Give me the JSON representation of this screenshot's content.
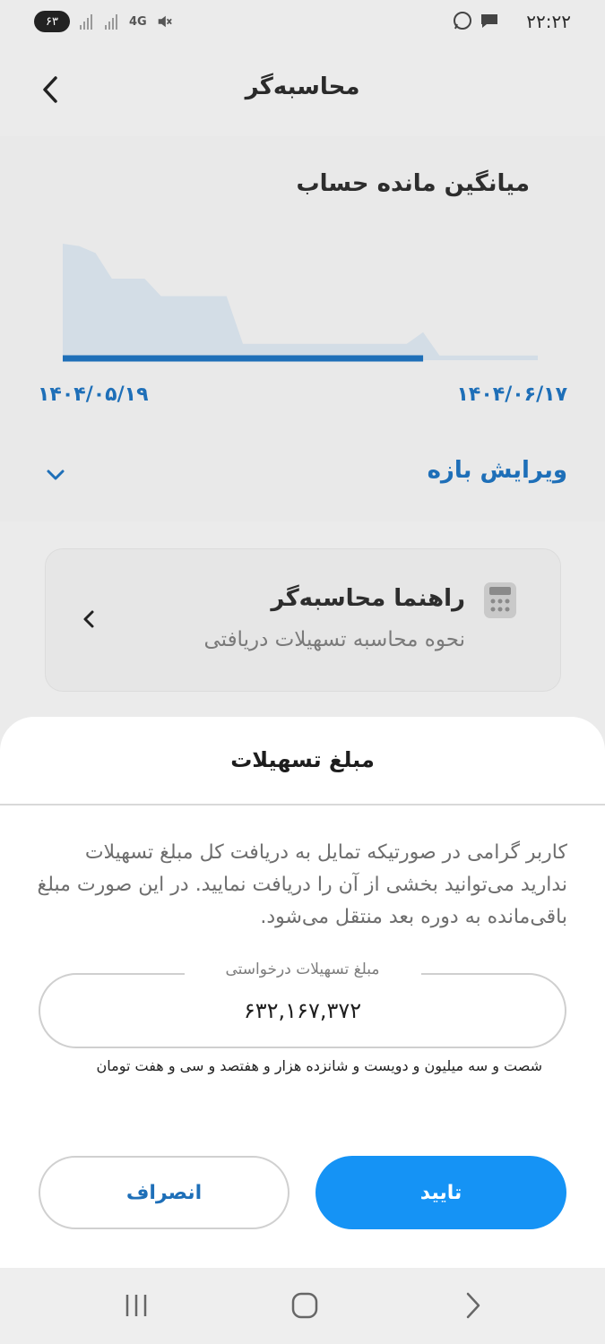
{
  "status_bar": {
    "time": "۲۲:۲۲",
    "battery": "۶۳",
    "network": "4G",
    "icons": [
      "whatsapp-icon",
      "message-icon",
      "mute-icon",
      "signal-icon"
    ]
  },
  "app_bar": {
    "title": "محاسبه‌گر",
    "back_icon": "chevron-left-icon"
  },
  "balance_card": {
    "title": "میانگین مانده حساب",
    "date_start": "۱۴۰۴/۰۵/۱۹",
    "date_end": "۱۴۰۴/۰۶/۱۷",
    "edit_range_label": "ویرایش بازه",
    "edit_icon": "chevron-down-icon",
    "accent_color": "#1e6fb8"
  },
  "chart_data": {
    "type": "area",
    "title": "میانگین مانده حساب",
    "x": [
      "۱۴۰۴/۰۵/۱۹",
      "",
      "",
      "",
      "",
      "",
      "",
      "",
      "",
      "",
      "",
      "",
      "",
      "",
      "",
      "",
      "",
      "",
      "",
      "",
      "",
      "",
      "",
      "",
      "",
      "",
      "",
      "",
      "",
      "۱۴۰۴/۰۶/۱۷"
    ],
    "series": [
      {
        "values": [
          100,
          98,
          92,
          70,
          70,
          70,
          55,
          55,
          55,
          55,
          55,
          14,
          14,
          14,
          14,
          14,
          14,
          14,
          14,
          14,
          14,
          14,
          24,
          4,
          4,
          4,
          4,
          4,
          4,
          4
        ]
      }
    ],
    "ylim": [
      0,
      100
    ],
    "grid": false
  },
  "guide_card": {
    "title": "راهنما محاسبه‌گر",
    "subtitle": "نحوه محاسبه تسهیلات دریافتی",
    "icon": "calculator-icon"
  },
  "sheet": {
    "title": "مبلغ تسهیلات",
    "description": "کاربر گرامی در صورتیکه تمایل به دریافت کل مبلغ تسهیلات ندارید می‌توانید بخشی از آن را دریافت نمایید. در این صورت مبلغ باقی‌مانده به دوره بعد منتقل می‌شود.",
    "field_label": "مبلغ تسهیلات درخواستی",
    "field_value": "۶۳۲,۱۶۷,۳۷۲",
    "amount_words": "شصت و سه میلیون و دویست و شانزده هزار و هفتصد و سی و هفت تومان",
    "confirm_label": "تایید",
    "cancel_label": "انصراف",
    "primary_color": "#1593f5"
  },
  "nav_bar": {
    "icons": [
      "recent-apps-icon",
      "home-icon",
      "back-icon"
    ]
  }
}
